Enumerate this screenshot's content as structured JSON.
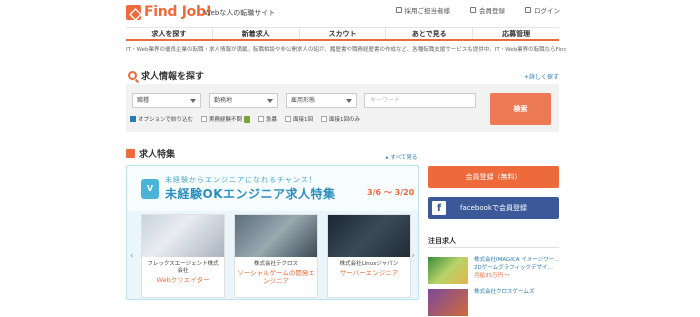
{
  "header": {
    "logo": "Find Job!",
    "tagline": "Webな人の転職サイト",
    "links": [
      "採用ご担当者様",
      "会員登録",
      "ログイン"
    ]
  },
  "nav": [
    "求人を探す",
    "新着求人",
    "スカウト",
    "あとで見る",
    "応募管理"
  ],
  "description": "IT・Web業界の優良企業の転職・求人情報が満載。転職相談や非公開求人の紹介、履歴書や職務経歴書の作成など、各種転職支援サービスも提供中。IT・Web業界の転職ならFind Job!",
  "search": {
    "title": "求人情報を探す",
    "detail_link": "+詳しく探す",
    "selects": [
      "職種",
      "勤務地",
      "雇用形態"
    ],
    "keyword_placeholder": "キーワード",
    "button": "検索",
    "checks_label": "オプションで絞り込む",
    "checks": [
      "実務経験不問",
      "急募",
      "面接1回",
      "面接1回のみ"
    ]
  },
  "featured": {
    "title": "求人特集",
    "all_link": "▸ すべて見る",
    "banner_line1": "未経験からエンジニアになれるチャンス！",
    "banner_line2": "未経験OKエンジニア求人特集",
    "banner_date": "3/6 ～ 3/20",
    "badge_char": "V",
    "cards": [
      {
        "company": "フレックスエージェント株式会社",
        "job": "Webクリエイター"
      },
      {
        "company": "株式会社テクロス",
        "job": "ソーシャルゲームの開発エンジニア"
      },
      {
        "company": "株式会社Linuxジャパン",
        "job": "サーバーエンジニア"
      }
    ]
  },
  "sidebar": {
    "register": "会員登録（無料）",
    "facebook": "facebookで会員登録",
    "fb_icon": "f",
    "attention_title": "注目求人",
    "attention": [
      {
        "name": "株式会社IMAGICA イメージワー…",
        "desc": "2Dゲームグラフィックデザイ…",
        "salary": "月給35万円 ～"
      },
      {
        "name": "株式会社クロスゲームズ",
        "desc": "",
        "salary": ""
      }
    ]
  },
  "colors": {
    "accent": "#ee6a3a",
    "link": "#2b7ab8",
    "facebook": "#3b5998"
  }
}
